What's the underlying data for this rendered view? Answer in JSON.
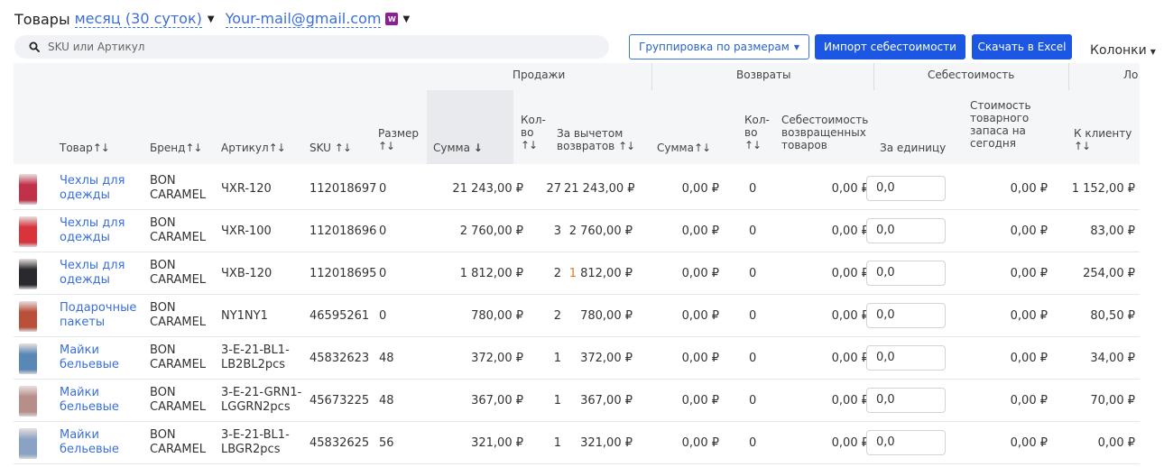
{
  "header": {
    "title": "Товары",
    "period": "месяц (30 суток)",
    "account": "Your-mail@gmail.com",
    "account_badge": "W"
  },
  "search": {
    "placeholder": "SKU или Артикул"
  },
  "toolbar": {
    "group_label": "Группировка по размерам",
    "import_label": "Импорт себестоимости",
    "excel_label": "Скачать в Excel",
    "columns_label": "Колонки"
  },
  "groups": {
    "sales": "Продажи",
    "returns": "Возвраты",
    "cost": "Себестоимость",
    "more": "Ло"
  },
  "columns": {
    "product": "Товар",
    "brand": "Бренд",
    "article": "Артикул",
    "sku": "SKU",
    "size_1": "Размер",
    "sales_sum": "Сумма",
    "qty_1": "Кол-",
    "qty_2": "во",
    "net_1": "За вычетом",
    "net_2": "возвратов",
    "ret_sum": "Сумма",
    "cost_returned_1": "Себестоимость",
    "cost_returned_2": "возвращенных",
    "cost_returned_3": "товаров",
    "per_unit": "За единицу",
    "stock_value_1": "Стоимость",
    "stock_value_2": "товарного",
    "stock_value_3": "запаса на",
    "stock_value_4": "сегодня",
    "to_client": "К клиенту",
    "sort_icon": "↑↓",
    "sort_desc": "↓"
  },
  "rows": [
    {
      "name1": "Чехлы для",
      "name2": "одежды",
      "brand1": "BON",
      "brand2": "CARAMEL",
      "art1": "ЧXR-120",
      "art2": "",
      "sku": "112018697",
      "size": "0",
      "sum": "21 243,00 ₽",
      "qty": "27",
      "net": "21 243,00 ₽",
      "ret_sum": "0,00 ₽",
      "ret_qty": "0",
      "ret_cost": "0,00 ₽",
      "unit_cost": "0,0",
      "stock": "0,00 ₽",
      "client": "1 152,00 ₽"
    },
    {
      "name1": "Чехлы для",
      "name2": "одежды",
      "brand1": "BON",
      "brand2": "CARAMEL",
      "art1": "ЧXR-100",
      "art2": "",
      "sku": "112018696",
      "size": "0",
      "sum": "2 760,00 ₽",
      "qty": "3",
      "net": "2 760,00 ₽",
      "ret_sum": "0,00 ₽",
      "ret_qty": "0",
      "ret_cost": "0,00 ₽",
      "unit_cost": "0,0",
      "stock": "0,00 ₽",
      "client": "83,00 ₽"
    },
    {
      "name1": "Чехлы для",
      "name2": "одежды",
      "brand1": "BON",
      "brand2": "CARAMEL",
      "art1": "ЧXB-120",
      "art2": "",
      "sku": "112018695",
      "size": "0",
      "sum": "1 812,00 ₽",
      "qty": "2",
      "net": "1 812,00 ₽",
      "ret_sum": "0,00 ₽",
      "ret_qty": "0",
      "ret_cost": "0,00 ₽",
      "unit_cost": "0,0",
      "stock": "0,00 ₽",
      "client": "254,00 ₽"
    },
    {
      "name1": "Подарочные",
      "name2": "пакеты",
      "brand1": "BON",
      "brand2": "CARAMEL",
      "art1": "NY1NY1",
      "art2": "",
      "sku": "46595261",
      "size": "0",
      "sum": "780,00 ₽",
      "qty": "2",
      "net": "780,00 ₽",
      "ret_sum": "0,00 ₽",
      "ret_qty": "0",
      "ret_cost": "0,00 ₽",
      "unit_cost": "0,0",
      "stock": "0,00 ₽",
      "client": "80,50 ₽"
    },
    {
      "name1": "Майки",
      "name2": "бельевые",
      "brand1": "BON",
      "brand2": "CARAMEL",
      "art1": "3-E-21-BL1-",
      "art2": "LB2BL2pcs",
      "sku": "45832623",
      "size": "48",
      "sum": "372,00 ₽",
      "qty": "1",
      "net": "372,00 ₽",
      "ret_sum": "0,00 ₽",
      "ret_qty": "0",
      "ret_cost": "0,00 ₽",
      "unit_cost": "0,0",
      "stock": "0,00 ₽",
      "client": "34,00 ₽"
    },
    {
      "name1": "Майки",
      "name2": "бельевые",
      "brand1": "BON",
      "brand2": "CARAMEL",
      "art1": "3-E-21-GRN1-",
      "art2": "LGGRN2pcs",
      "sku": "45673225",
      "size": "48",
      "sum": "367,00 ₽",
      "qty": "1",
      "net": "367,00 ₽",
      "ret_sum": "0,00 ₽",
      "ret_qty": "0",
      "ret_cost": "0,00 ₽",
      "unit_cost": "0,0",
      "stock": "0,00 ₽",
      "client": "70,00 ₽"
    },
    {
      "name1": "Майки",
      "name2": "бельевые",
      "brand1": "BON",
      "brand2": "CARAMEL",
      "art1": "3-E-21-BL1-",
      "art2": "LBGR2pcs",
      "sku": "45832625",
      "size": "56",
      "sum": "321,00 ₽",
      "qty": "1",
      "net": "321,00 ₽",
      "ret_sum": "0,00 ₽",
      "ret_qty": "0",
      "ret_cost": "0,00 ₽",
      "unit_cost": "0,0",
      "stock": "0,00 ₽",
      "client": "0,00 ₽"
    }
  ],
  "thumb_colors": [
    "#c2314a",
    "#d8343c",
    "#2a2a2e",
    "#b8503a",
    "#5a88b6",
    "#b78f8a",
    "#8aa3c4"
  ]
}
